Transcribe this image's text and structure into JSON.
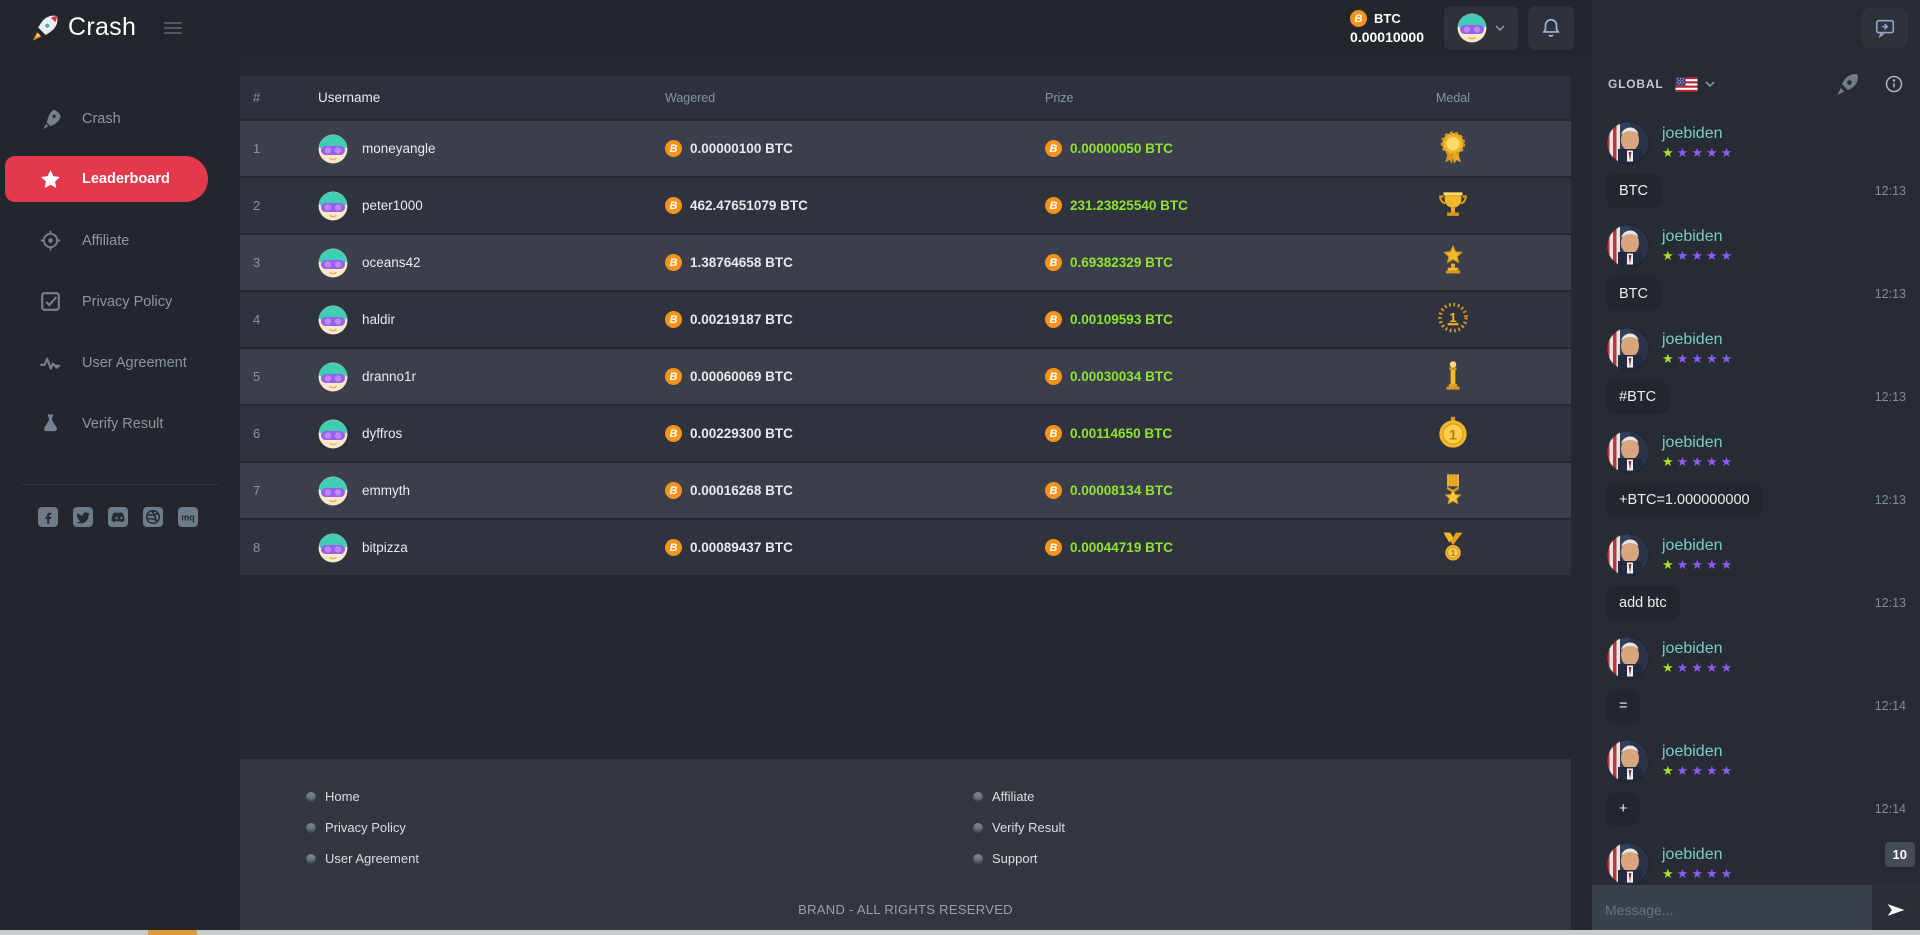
{
  "brand": {
    "name": "Crash",
    "logo_icon": "rocket-icon"
  },
  "topbar": {
    "balance": {
      "currency": "BTC",
      "amount": "0.00010000"
    }
  },
  "sidebar": {
    "items": [
      {
        "label": "Crash",
        "icon": "rocket-icon",
        "active": false
      },
      {
        "label": "Leaderboard",
        "icon": "star-icon",
        "active": true
      },
      {
        "label": "Affiliate",
        "icon": "target-icon",
        "active": false
      },
      {
        "label": "Privacy Policy",
        "icon": "checkbox-icon",
        "active": false
      },
      {
        "label": "User Agreement",
        "icon": "activity-icon",
        "active": false
      },
      {
        "label": "Verify Result",
        "icon": "flask-icon",
        "active": false
      }
    ],
    "social": [
      "facebook",
      "twitter",
      "discord",
      "dribbble",
      "medium"
    ]
  },
  "leaderboard": {
    "columns": [
      "#",
      "Username",
      "Wagered",
      "Prize",
      "Medal"
    ],
    "rows": [
      {
        "rank": "1",
        "username": "moneyangle",
        "wagered": "0.00000100 BTC",
        "prize": "0.00000050 BTC",
        "medal": "rosette-medal"
      },
      {
        "rank": "2",
        "username": "peter1000",
        "wagered": "462.47651079 BTC",
        "prize": "231.23825540 BTC",
        "medal": "trophy-cup"
      },
      {
        "rank": "3",
        "username": "oceans42",
        "wagered": "1.38764658 BTC",
        "prize": "0.69382329 BTC",
        "medal": "star-trophy"
      },
      {
        "rank": "4",
        "username": "haldir",
        "wagered": "0.00219187 BTC",
        "prize": "0.00109593 BTC",
        "medal": "laurel-wreath"
      },
      {
        "rank": "5",
        "username": "dranno1r",
        "wagered": "0.00060069 BTC",
        "prize": "0.00030034 BTC",
        "medal": "pillar-trophy"
      },
      {
        "rank": "6",
        "username": "dyffros",
        "wagered": "0.00229300 BTC",
        "prize": "0.00114650 BTC",
        "medal": "gold-coin"
      },
      {
        "rank": "7",
        "username": "emmyth",
        "wagered": "0.00016268 BTC",
        "prize": "0.00008134 BTC",
        "medal": "star-ribbon-medal"
      },
      {
        "rank": "8",
        "username": "bitpizza",
        "wagered": "0.00089437 BTC",
        "prize": "0.00044719 BTC",
        "medal": "neck-medal"
      }
    ]
  },
  "footer": {
    "links_left": [
      "Home",
      "Privacy Policy",
      "User Agreement"
    ],
    "links_right": [
      "Affiliate",
      "Verify Result",
      "Support"
    ],
    "copyright": "BRAND - ALL RIGHTS RESERVED"
  },
  "chat": {
    "channel": "GLOBAL",
    "flag": "us-flag",
    "unread_count": "10",
    "input_placeholder": "Message...",
    "rating_max": 5,
    "messages": [
      {
        "user": "joebiden",
        "rating": 1,
        "text": "BTC",
        "time": "12:13"
      },
      {
        "user": "joebiden",
        "rating": 1,
        "text": "BTC",
        "time": "12:13"
      },
      {
        "user": "joebiden",
        "rating": 1,
        "text": "#BTC",
        "time": "12:13"
      },
      {
        "user": "joebiden",
        "rating": 1,
        "text": "+BTC=1.000000000",
        "time": "12:13"
      },
      {
        "user": "joebiden",
        "rating": 1,
        "text": "add btc",
        "time": "12:13"
      },
      {
        "user": "joebiden",
        "rating": 1,
        "text": "=",
        "time": "12:14"
      },
      {
        "user": "joebiden",
        "rating": 1,
        "text": "+",
        "time": "12:14"
      },
      {
        "user": "joebiden",
        "rating": 1,
        "text": "",
        "time": ""
      }
    ]
  },
  "colors": {
    "accent_red": "#e3394a",
    "bitcoin_orange": "#f7931a",
    "prize_green": "#90e32e",
    "chat_name_teal": "#79ccc9",
    "star_purple": "#8b5cf6",
    "star_green": "#a8e22c"
  }
}
